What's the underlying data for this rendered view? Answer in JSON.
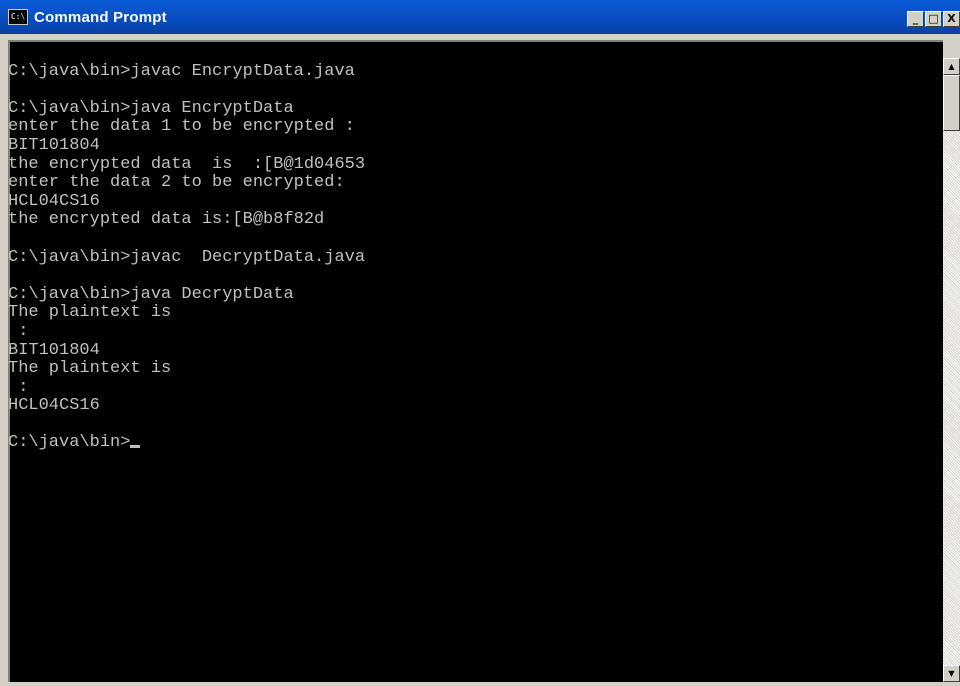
{
  "window": {
    "title": "Command Prompt",
    "icon": "console-icon",
    "icon_glyph": "C:\\",
    "controls": {
      "minimize": "_",
      "maximize": "□",
      "close": "X"
    }
  },
  "console": {
    "lines": [
      "",
      "C:\\java\\bin>javac EncryptData.java",
      "",
      "C:\\java\\bin>java EncryptData",
      "enter the data 1 to be encrypted :",
      "BIT101804",
      "the encrypted data  is  :[B@1d04653",
      "enter the data 2 to be encrypted:",
      "HCL04CS16",
      "the encrypted data is:[B@b8f82d",
      "",
      "C:\\java\\bin>javac  DecryptData.java",
      "",
      "C:\\java\\bin>java DecryptData",
      "The plaintext is",
      " :",
      "BIT101804",
      "The plaintext is",
      " :",
      "HCL04CS16",
      "",
      "C:\\java\\bin>"
    ],
    "colors": {
      "background": "#000000",
      "foreground": "#c0c0c0"
    }
  },
  "scrollbar": {
    "up_arrow": "▲",
    "down_arrow": "▼"
  }
}
